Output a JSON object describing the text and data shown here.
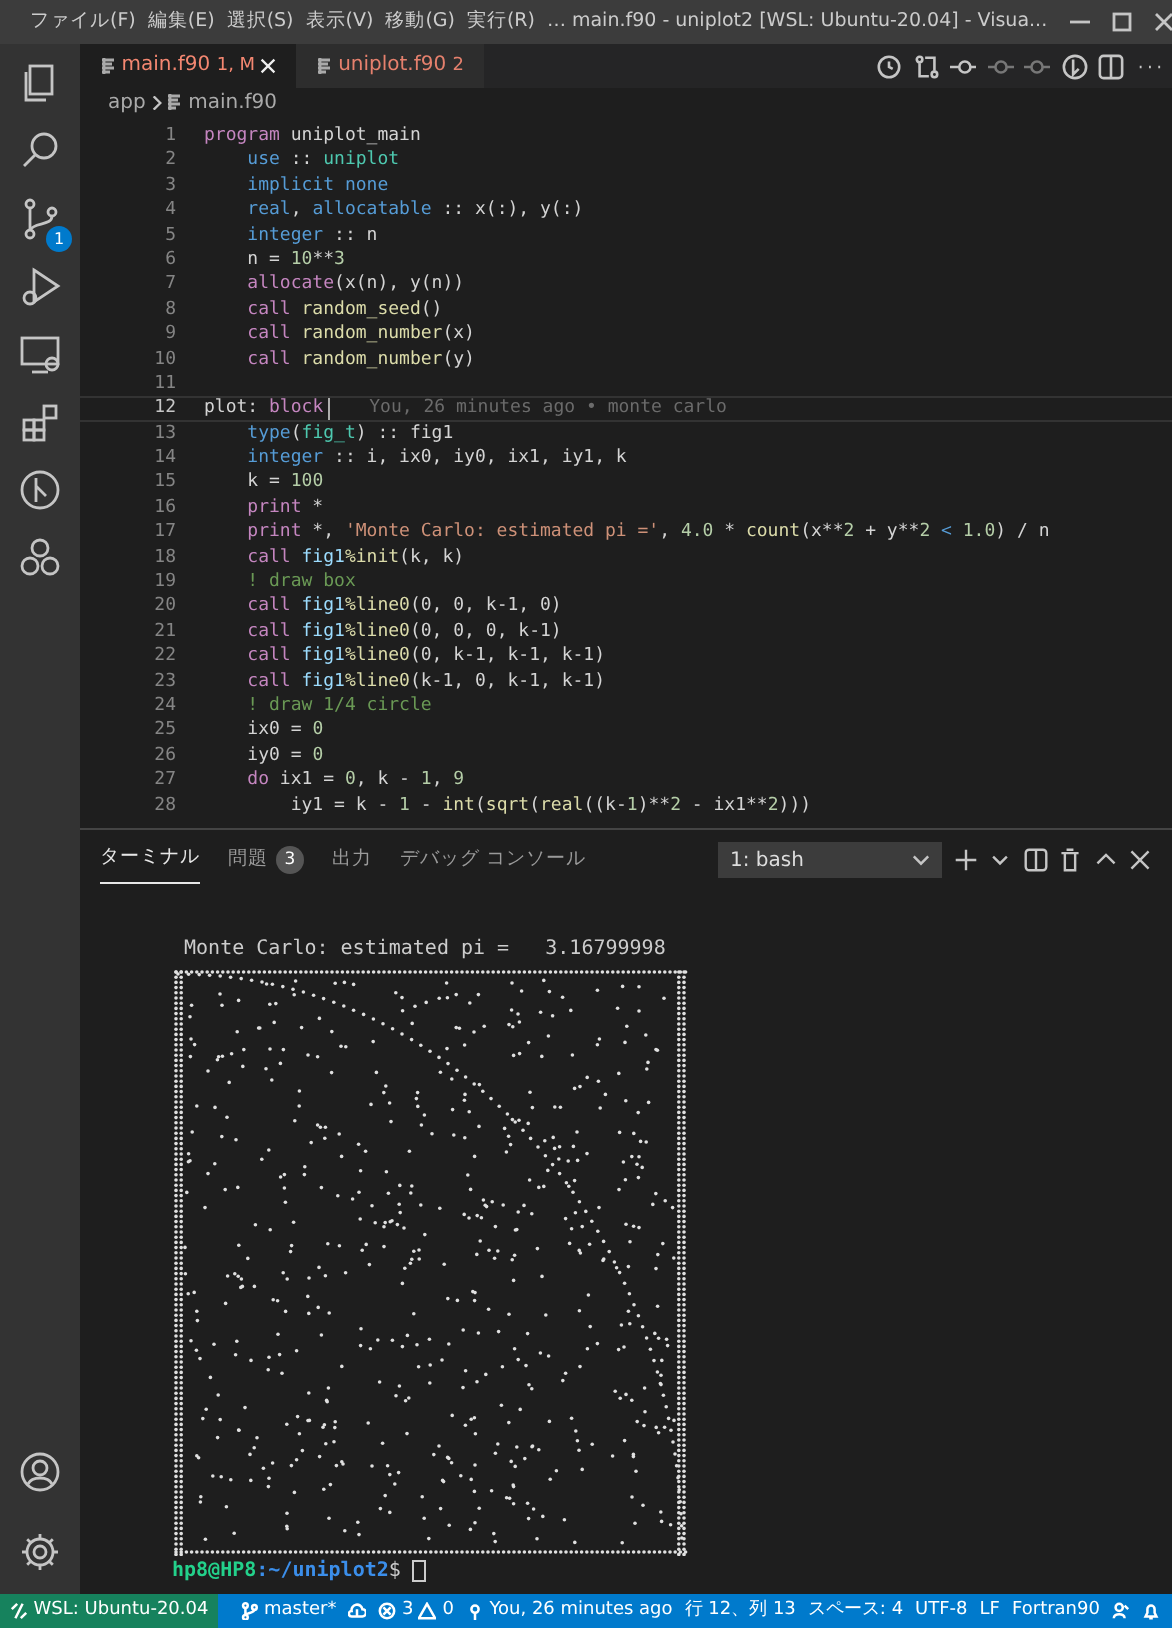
{
  "title_bar": {
    "menu": [
      "ファイル(F)",
      "編集(E)",
      "選択(S)",
      "表示(V)",
      "移動(G)",
      "実行(R)",
      "…"
    ],
    "title": "main.f90 - uniplot2 [WSL: Ubuntu-20.04] - Visua..."
  },
  "activity_bar": {
    "source_control_badge": "1"
  },
  "tabs": [
    {
      "label": "main.f90",
      "status": "1, M",
      "selected": true
    },
    {
      "label": "uniplot.f90",
      "status": "2",
      "selected": false
    }
  ],
  "breadcrumb": [
    "app",
    "main.f90"
  ],
  "editor": {
    "blame": "You, 26 minutes ago • monte carlo",
    "lines": [
      {
        "num": "1",
        "current": false,
        "tokens": [
          {
            "kind": "kw",
            "text": "program"
          },
          {
            "kind": "plain",
            "text": " uniplot_main"
          }
        ],
        "children": [
          {
            "num": "2",
            "current": false,
            "tokens": [
              {
                "kind": "type",
                "text": "use"
              },
              {
                "kind": "plain",
                "text": " :: "
              },
              {
                "kind": "mod",
                "text": "uniplot"
              }
            ]
          },
          {
            "num": "3",
            "current": false,
            "tokens": [
              {
                "kind": "type",
                "text": "implicit none"
              }
            ]
          },
          {
            "num": "4",
            "current": false,
            "tokens": [
              {
                "kind": "type",
                "text": "real"
              },
              {
                "kind": "plain",
                "text": ", "
              },
              {
                "kind": "type",
                "text": "allocatable"
              },
              {
                "kind": "plain",
                "text": " :: x(:), y(:)"
              }
            ]
          },
          {
            "num": "5",
            "current": false,
            "tokens": [
              {
                "kind": "type",
                "text": "integer"
              },
              {
                "kind": "plain",
                "text": " :: n"
              }
            ]
          },
          {
            "num": "6",
            "current": false,
            "tokens": [
              {
                "kind": "plain",
                "text": "n = "
              },
              {
                "kind": "num",
                "text": "10"
              },
              {
                "kind": "plain",
                "text": "**"
              },
              {
                "kind": "num",
                "text": "3"
              }
            ]
          },
          {
            "num": "7",
            "current": false,
            "tokens": [
              {
                "kind": "kw",
                "text": "allocate"
              },
              {
                "kind": "plain",
                "text": "(x(n), y(n))"
              }
            ]
          },
          {
            "num": "8",
            "current": false,
            "tokens": [
              {
                "kind": "kw",
                "text": "call "
              },
              {
                "kind": "fn",
                "text": "random_seed"
              },
              {
                "kind": "plain",
                "text": "()"
              }
            ]
          },
          {
            "num": "9",
            "current": false,
            "tokens": [
              {
                "kind": "kw",
                "text": "call "
              },
              {
                "kind": "fn",
                "text": "random_number"
              },
              {
                "kind": "plain",
                "text": "(x)"
              }
            ]
          },
          {
            "num": "10",
            "current": false,
            "tokens": [
              {
                "kind": "kw",
                "text": "call "
              },
              {
                "kind": "fn",
                "text": "random_number"
              },
              {
                "kind": "plain",
                "text": "(y)"
              }
            ]
          }
        ]
      },
      {
        "num": "11",
        "current": false
      },
      {
        "num": "12",
        "current": true,
        "tokens": [
          {
            "kind": "plain",
            "text": "plot: "
          },
          {
            "kind": "kw",
            "text": "block"
          }
        ],
        "children": [
          {
            "num": "13",
            "current": false,
            "tokens": [
              {
                "kind": "type",
                "text": "type"
              },
              {
                "kind": "plain",
                "text": "("
              },
              {
                "kind": "mod",
                "text": "fig_t"
              },
              {
                "kind": "plain",
                "text": ") :: fig1"
              }
            ]
          },
          {
            "num": "14",
            "current": false,
            "tokens": [
              {
                "kind": "type",
                "text": "integer"
              },
              {
                "kind": "plain",
                "text": " :: i, ix0, iy0, ix1, iy1, k"
              }
            ]
          },
          {
            "num": "15",
            "current": false,
            "tokens": [
              {
                "kind": "plain",
                "text": "k = "
              },
              {
                "kind": "num",
                "text": "100"
              }
            ]
          },
          {
            "num": "16",
            "current": false,
            "tokens": [
              {
                "kind": "kw",
                "text": "print"
              },
              {
                "kind": "plain",
                "text": " *"
              }
            ]
          },
          {
            "num": "17",
            "current": false,
            "tokens": [
              {
                "kind": "kw",
                "text": "print"
              },
              {
                "kind": "plain",
                "text": " *, "
              },
              {
                "kind": "str",
                "text": "'Monte Carlo: estimated pi ='"
              },
              {
                "kind": "plain",
                "text": ", "
              },
              {
                "kind": "num",
                "text": "4.0"
              },
              {
                "kind": "plain",
                "text": " * "
              },
              {
                "kind": "fn",
                "text": "count"
              },
              {
                "kind": "plain",
                "text": "(x**"
              },
              {
                "kind": "num",
                "text": "2"
              },
              {
                "kind": "plain",
                "text": " + y**"
              },
              {
                "kind": "num",
                "text": "2"
              },
              {
                "kind": "type",
                "text": " < "
              },
              {
                "kind": "num",
                "text": "1.0"
              },
              {
                "kind": "plain",
                "text": ") / n"
              }
            ]
          },
          {
            "num": "18",
            "current": false,
            "tokens": [
              {
                "kind": "kw",
                "text": "call "
              },
              {
                "kind": "var",
                "text": "fig1"
              },
              {
                "kind": "fn",
                "text": "%init"
              },
              {
                "kind": "plain",
                "text": "(k, k)"
              }
            ]
          },
          {
            "num": "19",
            "current": false,
            "tokens": [
              {
                "kind": "com",
                "text": "! draw box"
              }
            ]
          },
          {
            "num": "20",
            "current": false,
            "tokens": [
              {
                "kind": "kw",
                "text": "call "
              },
              {
                "kind": "var",
                "text": "fig1"
              },
              {
                "kind": "fn",
                "text": "%line0"
              },
              {
                "kind": "plain",
                "text": "(0, 0, k-1, 0)"
              }
            ]
          },
          {
            "num": "21",
            "current": false,
            "tokens": [
              {
                "kind": "kw",
                "text": "call "
              },
              {
                "kind": "var",
                "text": "fig1"
              },
              {
                "kind": "fn",
                "text": "%line0"
              },
              {
                "kind": "plain",
                "text": "(0, 0, 0, k-1)"
              }
            ]
          },
          {
            "num": "22",
            "current": false,
            "tokens": [
              {
                "kind": "kw",
                "text": "call "
              },
              {
                "kind": "var",
                "text": "fig1"
              },
              {
                "kind": "fn",
                "text": "%line0"
              },
              {
                "kind": "plain",
                "text": "(0, k-1, k-1, k-1)"
              }
            ]
          },
          {
            "num": "23",
            "current": false,
            "tokens": [
              {
                "kind": "kw",
                "text": "call "
              },
              {
                "kind": "var",
                "text": "fig1"
              },
              {
                "kind": "fn",
                "text": "%line0"
              },
              {
                "kind": "plain",
                "text": "(k-1, 0, k-1, k-1)"
              }
            ]
          },
          {
            "num": "24",
            "current": false,
            "tokens": [
              {
                "kind": "com",
                "text": "! draw 1/4 circle"
              }
            ]
          },
          {
            "num": "25",
            "current": false,
            "tokens": [
              {
                "kind": "plain",
                "text": "ix0 = "
              },
              {
                "kind": "num",
                "text": "0"
              }
            ]
          },
          {
            "num": "26",
            "current": false,
            "tokens": [
              {
                "kind": "plain",
                "text": "iy0 = "
              },
              {
                "kind": "num",
                "text": "0"
              }
            ]
          },
          {
            "num": "27",
            "current": false,
            "tokens": [
              {
                "kind": "kw",
                "text": "do"
              },
              {
                "kind": "plain",
                "text": " ix1 = "
              },
              {
                "kind": "num",
                "text": "0"
              },
              {
                "kind": "plain",
                "text": ", k - "
              },
              {
                "kind": "num",
                "text": "1"
              },
              {
                "kind": "plain",
                "text": ", "
              },
              {
                "kind": "num",
                "text": "9"
              }
            ],
            "children": [
              {
                "num": "28",
                "current": false,
                "tokens": [
                  {
                    "kind": "plain",
                    "text": "iy1 = k - "
                  },
                  {
                    "kind": "num",
                    "text": "1"
                  },
                  {
                    "kind": "plain",
                    "text": " - "
                  },
                  {
                    "kind": "fn",
                    "text": "int"
                  },
                  {
                    "kind": "plain",
                    "text": "("
                  },
                  {
                    "kind": "fn",
                    "text": "sqrt"
                  },
                  {
                    "kind": "plain",
                    "text": "("
                  },
                  {
                    "kind": "fn",
                    "text": "real"
                  },
                  {
                    "kind": "plain",
                    "text": "((k-"
                  },
                  {
                    "kind": "num",
                    "text": "1"
                  },
                  {
                    "kind": "plain",
                    "text": ")**"
                  },
                  {
                    "kind": "num",
                    "text": "2"
                  },
                  {
                    "kind": "plain",
                    "text": " - ix1**"
                  },
                  {
                    "kind": "num",
                    "text": "2"
                  },
                  {
                    "kind": "plain",
                    "text": ")))"
                  }
                ]
              }
            ]
          }
        ]
      }
    ]
  },
  "panel": {
    "tabs": [
      {
        "label": "ターミナル",
        "selected": true
      },
      {
        "label": "問題",
        "count": "3",
        "selected": false
      },
      {
        "label": "出力",
        "selected": false
      },
      {
        "label": "デバッグ コンソール",
        "selected": false
      }
    ],
    "terminal_select": "1: bash",
    "output": " Monte Carlo: estimated pi =   3.16799998",
    "prompt": {
      "user": "hp8@HP8",
      "path": ":~/uniplot2",
      "symbol": "$"
    }
  },
  "status_bar": {
    "remote": "WSL: Ubuntu-20.04",
    "branch": "master*",
    "errors": "3",
    "warnings": "0",
    "blame": "You, 26 minutes ago",
    "position": "行 12、列 13",
    "indent": "スペース: 4",
    "encoding": "UTF-8",
    "eol": "LF",
    "language": "Fortran90"
  }
}
